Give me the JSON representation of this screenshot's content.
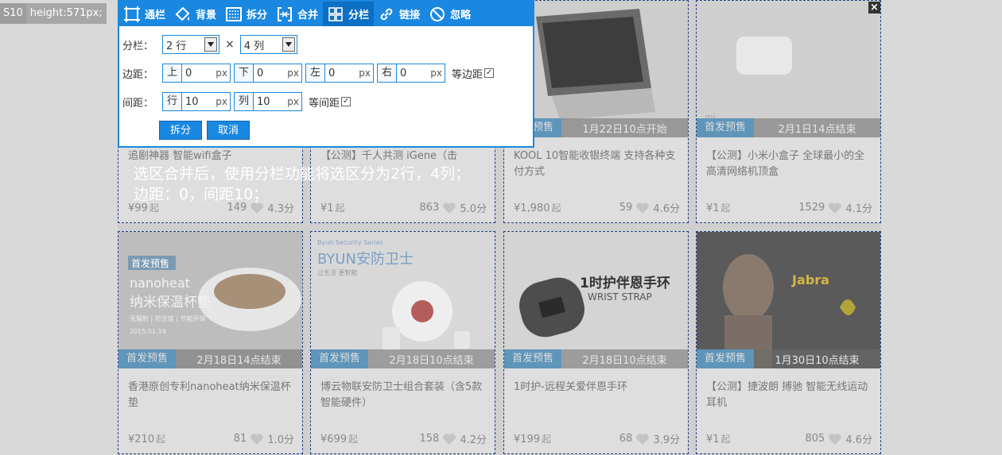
{
  "tag": {
    "id": "S10",
    "height_label": "height:571px;"
  },
  "close_label": "×",
  "note": [
    "选区合并后，使用分栏功能将选区分为2行，4列；",
    "边距：0，间距10；"
  ],
  "colors": {
    "accent": "#1a88e0",
    "badge": "#5f95b9",
    "border": "#1f3e82"
  },
  "dialog": {
    "tabs": [
      {
        "label": "通栏",
        "icon": "fullwidth-icon"
      },
      {
        "label": "背景",
        "icon": "paint-bucket-icon"
      },
      {
        "label": "拆分",
        "icon": "split-icon"
      },
      {
        "label": "合并",
        "icon": "merge-icon"
      },
      {
        "label": "分栏",
        "icon": "columns-icon"
      },
      {
        "label": "链接",
        "icon": "link-icon"
      },
      {
        "label": "忽略",
        "icon": "ignore-icon"
      }
    ],
    "active_tab": "分栏",
    "columns_label": "分栏：",
    "rows_value": "2 行",
    "times": "×",
    "cols_value": "4 列",
    "margin_label": "边距：",
    "margins": [
      {
        "prefix": "上",
        "value": "0",
        "unit": "px"
      },
      {
        "prefix": "下",
        "value": "0",
        "unit": "px"
      },
      {
        "prefix": "左",
        "value": "0",
        "unit": "px"
      },
      {
        "prefix": "右",
        "value": "0",
        "unit": "px"
      }
    ],
    "equal_margin": "等边距",
    "gap_label": "间距：",
    "gaps": [
      {
        "prefix": "行",
        "value": "10",
        "unit": "px"
      },
      {
        "prefix": "列",
        "value": "10",
        "unit": "px"
      }
    ],
    "equal_gap": "等间距",
    "split_button": "拆分",
    "cancel_button": "取消"
  },
  "cards": [
    {
      "badge": "",
      "time": "",
      "title": "追剧神器 智能wifi盒子",
      "price": "¥99",
      "suffix": "起",
      "likes": "149",
      "score": "4.3分"
    },
    {
      "badge": "",
      "time": "",
      "title": "【公测】千人共测 iGene（击",
      "price": "¥1",
      "suffix": "起",
      "likes": "863",
      "score": "5.0分"
    },
    {
      "badge": "首发预售",
      "time": "1月22日10点开始",
      "title": "KOOL 10智能收银终端 支持各种支付方式",
      "price": "¥1,980",
      "suffix": "起",
      "likes": "59",
      "score": "4.6分"
    },
    {
      "badge": "首发预售",
      "time": "2月1日14点结束",
      "title": "【公测】小米小盒子 全球最小的全高清网络机顶盒",
      "price": "¥1",
      "suffix": "起",
      "likes": "1529",
      "score": "4.1分"
    },
    {
      "badge": "首发预售",
      "time": "2月18日14点结束",
      "title": "香港原创专利nanoheat纳米保温杯垫",
      "price": "¥210",
      "suffix": "起",
      "likes": "81",
      "score": "1.0分"
    },
    {
      "badge": "首发预售",
      "time": "2月18日10点结束",
      "title": "博云物联安防卫士组合套装（含5款智能硬件）",
      "price": "¥699",
      "suffix": "起",
      "likes": "158",
      "score": "4.2分"
    },
    {
      "badge": "首发预售",
      "time": "2月18日10点结束",
      "title": "1时护-远程关爱伴恩手环",
      "price": "¥199",
      "suffix": "起",
      "likes": "68",
      "score": "3.9分"
    },
    {
      "badge": "首发预售",
      "time": "1月30日10点结束",
      "title": "【公测】捷波朗 搏驰 智能无线运动耳机",
      "price": "¥1",
      "suffix": "起",
      "likes": "805",
      "score": "4.6分"
    }
  ],
  "images": {
    "nano_badge": "首发预售",
    "nano_brand": "nanoheat",
    "nano_name": "纳米保温杯垫",
    "nano_sub": "无辐射 | 防空烧 | 节能环保",
    "nano_date": "2015.01.19",
    "byun_top": "Byun Security Series",
    "byun_title": "BYUN安防卫士",
    "byun_sub": "让生活 更智能",
    "band_title": "1时护伴恩手环",
    "band_sub": "WRIST STRAP",
    "jabra_brand": "Jabra",
    "mi_brand": "mi"
  }
}
